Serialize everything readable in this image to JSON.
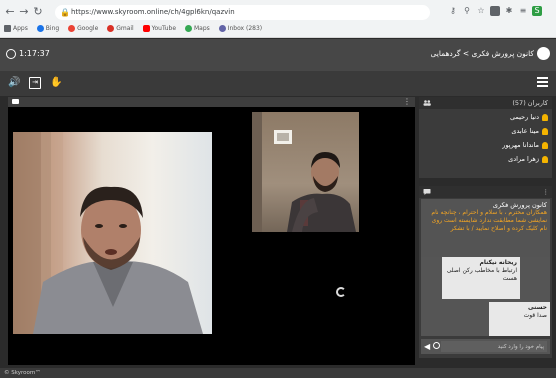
{
  "browser": {
    "url": "https://www.skyroom.online/ch/4gpl6kn/qazvin",
    "bookmarks": [
      "Apps",
      "Bing",
      "Google",
      "Gmail",
      "YouTube",
      "Maps",
      "Inbox (283)"
    ]
  },
  "header": {
    "clock": "1:17:37",
    "room_title": "کانون پرورش فکری > گردهمایی"
  },
  "users_panel": {
    "title": "کاربران (57)",
    "users": [
      "دنیا رحیمی",
      "مینا عابدی",
      "ماندانا مهرپور",
      "زهرا مرادی"
    ]
  },
  "chat": {
    "messages": [
      {
        "author": "کانون پرورش فکری",
        "text": "همکاران محترم ، با سلام و احترام ، چنانچه نام نمایشی شما مطابقت ندارد شایسته است روی نام کلیک کرده و اصلاح نمایید / با تشکر"
      },
      {
        "author": "ریحانه نیکنام",
        "text": "ارتباط با مخاطب رکن اصلی هست"
      },
      {
        "author": "حسنی",
        "text": "صدا قوت"
      }
    ],
    "input_placeholder": "پیام خود را وارد کنید"
  },
  "footer": {
    "brand": "© Skyroom™"
  },
  "colors": {
    "accent": "#f5a623",
    "user_icon": "#f5b400"
  }
}
